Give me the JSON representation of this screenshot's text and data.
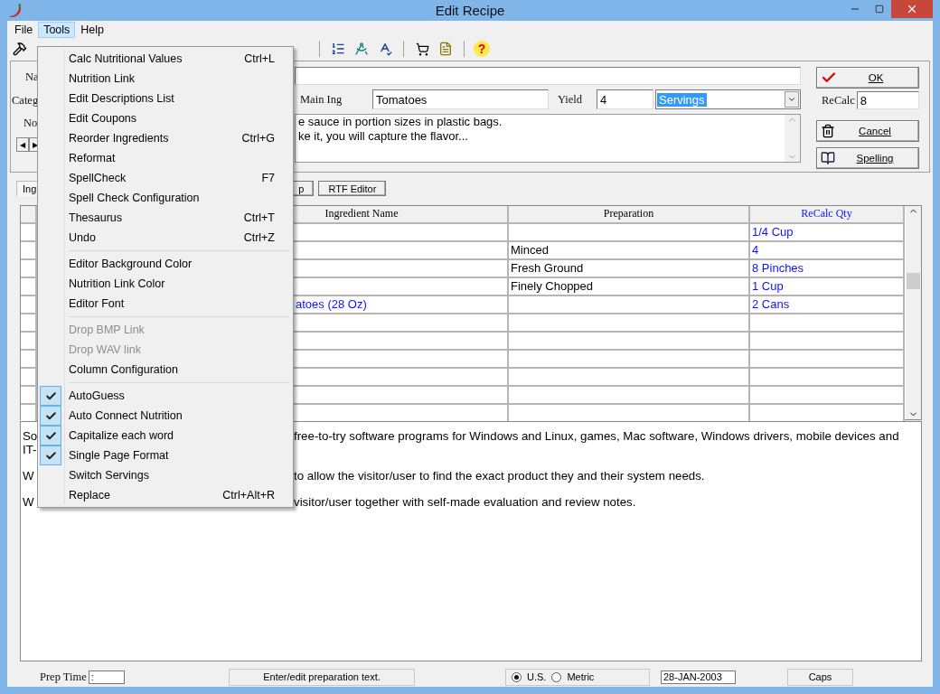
{
  "window": {
    "title": "Edit Recipe"
  },
  "menubar": [
    {
      "label": "File",
      "selected": false
    },
    {
      "label": "Tools",
      "selected": true
    },
    {
      "label": "Help",
      "selected": false
    }
  ],
  "form": {
    "name_label": "Na",
    "category_label": "Categ",
    "notes_label": "No",
    "main_ing_label": "Main Ing",
    "main_ing": "Tomatoes",
    "yield_label": "Yield",
    "yield": "4",
    "yield_unit": "Servings",
    "notes": [
      "e sauce in portion sizes in plastic bags.",
      "ke it, you will capture the flavor..."
    ]
  },
  "side": {
    "ok": "OK",
    "recalc_label": "ReCalc",
    "recalc": "8",
    "cancel": "Cancel",
    "spelling": "Spelling"
  },
  "toolbar": {
    "help": "?"
  },
  "nav": [
    "◀",
    "▶"
  ],
  "tab_row": {
    "tab": "Ing",
    "buttons": [
      "p",
      "RTF Editor"
    ]
  },
  "table": {
    "columns": [
      "Ingredient Name",
      "Preparation",
      "ReCalc Qty"
    ],
    "rows": [
      {
        "qty": "1/4 Cup"
      },
      {
        "preparation": "Minced",
        "qty": "4"
      },
      {
        "preparation": "Fresh Ground",
        "qty": "8 Pinches"
      },
      {
        "preparation": "Finely Chopped",
        "qty": "1 Cup"
      },
      {
        "name": "atoes (28 Oz)",
        "name_linked": true,
        "qty": "2 Cans"
      },
      {},
      {},
      {},
      {},
      {},
      {}
    ]
  },
  "editor": {
    "paragraphs": [
      [
        {
          "left": "So",
          "right": "free-to-try software programs for Windows and Linux, games, Mac software, Windows drivers, mobile devices and"
        },
        {
          "left": "IT-"
        }
      ],
      [
        {
          "left": "W",
          "right": "to allow the visitor/user to find the exact product they and their system needs."
        }
      ],
      [
        {
          "left": "W",
          "right": "visitor/user together with self-made evaluation and review notes."
        }
      ]
    ]
  },
  "status_bar": {
    "prep_time_label": "Prep Time",
    "prep_time": ":",
    "message": "Enter/edit preparation text.",
    "units": [
      {
        "label": "U.S.",
        "selected": true
      },
      {
        "label": "Metric",
        "selected": false
      }
    ],
    "date": "28-JAN-2003",
    "caps": "Caps"
  },
  "tools_menu": {
    "groups": [
      [
        {
          "label": "Calc Nutritional Values",
          "shortcut": "Ctrl+L",
          "checked": false,
          "disabled": false
        },
        {
          "label": "Nutrition Link",
          "checked": false,
          "disabled": false
        },
        {
          "label": "Edit Descriptions List",
          "checked": false,
          "disabled": false
        },
        {
          "label": "Edit Coupons",
          "checked": false,
          "disabled": false
        },
        {
          "label": "Reorder Ingredients",
          "shortcut": "Ctrl+G",
          "checked": false,
          "disabled": false
        },
        {
          "label": "Reformat",
          "checked": false,
          "disabled": false
        },
        {
          "label": "SpellCheck",
          "shortcut": "F7",
          "checked": false,
          "disabled": false
        },
        {
          "label": "Spell Check Configuration",
          "checked": false,
          "disabled": false
        },
        {
          "label": "Thesaurus",
          "shortcut": "Ctrl+T",
          "checked": false,
          "disabled": false
        },
        {
          "label": "Undo",
          "shortcut": "Ctrl+Z",
          "checked": false,
          "disabled": false
        }
      ],
      [
        {
          "label": "Editor Background Color",
          "checked": false,
          "disabled": false
        },
        {
          "label": "Nutrition Link Color",
          "checked": false,
          "disabled": false
        },
        {
          "label": "Editor Font",
          "checked": false,
          "disabled": false
        }
      ],
      [
        {
          "label": "Drop BMP Link",
          "checked": false,
          "disabled": true
        },
        {
          "label": "Drop WAV link",
          "checked": false,
          "disabled": true
        },
        {
          "label": "Column Configuration",
          "checked": false,
          "disabled": false
        }
      ],
      [
        {
          "label": "AutoGuess",
          "checked": true,
          "disabled": false
        },
        {
          "label": "Auto Connect Nutrition",
          "checked": true,
          "disabled": false
        },
        {
          "label": "Capitalize each word",
          "checked": true,
          "disabled": false
        },
        {
          "label": "Single Page Format",
          "checked": true,
          "disabled": false
        },
        {
          "label": "Switch Servings",
          "checked": false,
          "disabled": false
        },
        {
          "label": "Replace",
          "shortcut": "Ctrl+Alt+R",
          "checked": false,
          "disabled": false
        }
      ]
    ]
  }
}
